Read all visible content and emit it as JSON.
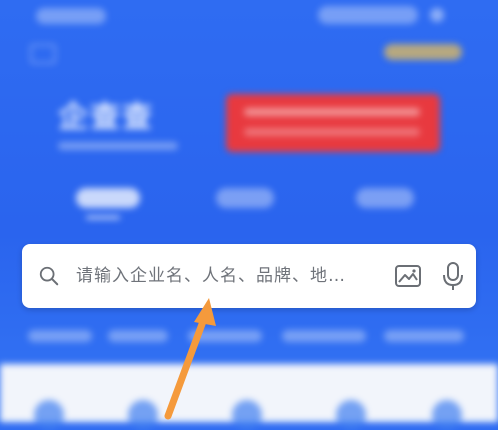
{
  "app": {
    "logo_text": "企查查"
  },
  "search": {
    "placeholder": "请输入企业名、人名、品牌、地…",
    "icons": [
      "search-icon",
      "image-search-icon",
      "microphone-icon"
    ]
  },
  "tabs": [
    {
      "name": "tab-1",
      "active": true
    },
    {
      "name": "tab-2",
      "active": false
    },
    {
      "name": "tab-3",
      "active": false
    }
  ],
  "annotation": {
    "type": "arrow",
    "color": "#f59a3c"
  },
  "colors": {
    "header_blue": "#2f6cf2",
    "promo_red": "#e8393f",
    "arrow_orange": "#f59a3c"
  }
}
